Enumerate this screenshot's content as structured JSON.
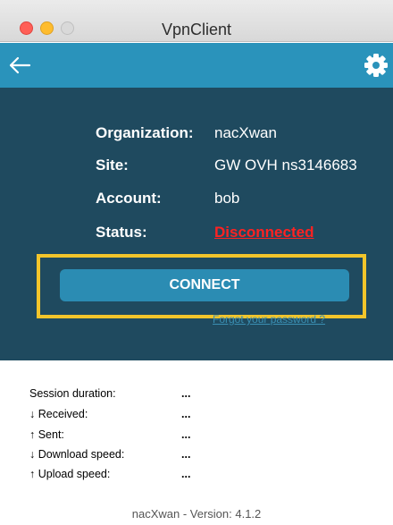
{
  "window": {
    "title": "VpnClient"
  },
  "toolbar": {
    "back_icon": "arrow-left-icon",
    "settings_icon": "gear-icon"
  },
  "info": {
    "rows": [
      {
        "label": "Organization:",
        "value": "nacXwan"
      },
      {
        "label": "Site:",
        "value": "GW OVH ns3146683"
      },
      {
        "label": "Account:",
        "value": "bob"
      },
      {
        "label": "Status:",
        "value": "Disconnected"
      }
    ]
  },
  "actions": {
    "connect_label": "CONNECT",
    "forgot_password_label": "Forgot your password ?"
  },
  "session": {
    "rows": [
      {
        "label": "Session duration:",
        "value": "..."
      },
      {
        "label": "↓ Received:",
        "value": "..."
      },
      {
        "label": "↑ Sent:",
        "value": "..."
      },
      {
        "label": "↓ Download speed:",
        "value": "..."
      },
      {
        "label": "↑ Upload speed:",
        "value": "..."
      }
    ]
  },
  "footer": {
    "version_text": "nacXwan - Version: 4.1.2"
  },
  "colors": {
    "toolbar": "#2a93bb",
    "panel": "#1f4a5f",
    "status_disconnected": "#ff2222",
    "highlight": "#f2c52b"
  }
}
